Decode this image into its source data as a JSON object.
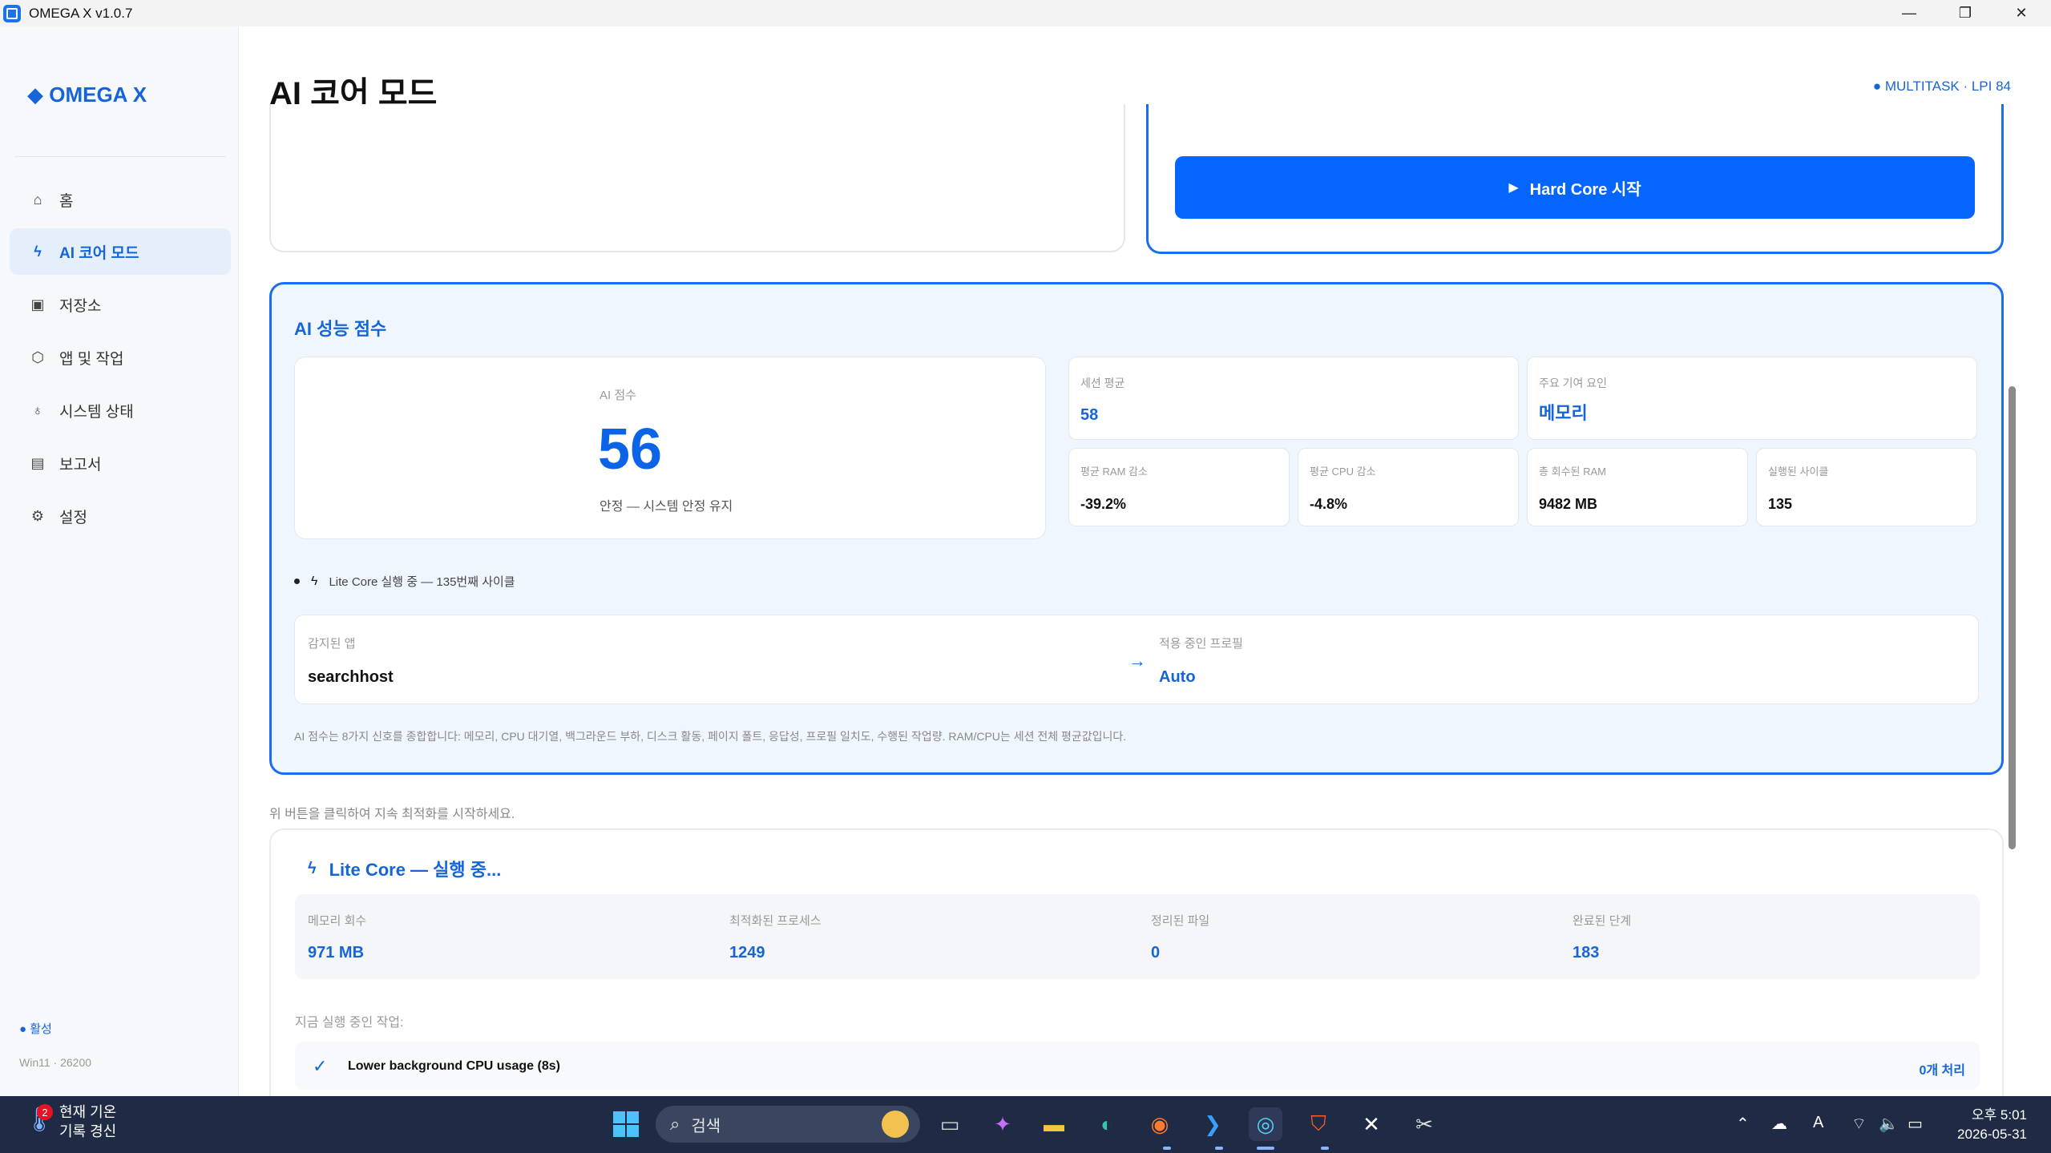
{
  "window": {
    "title": "OMEGA X v1.0.7",
    "controls": [
      "—",
      "❐",
      "✕"
    ]
  },
  "sidebar": {
    "brand": "◆ OMEGA X",
    "items": [
      {
        "label": "홈",
        "icon": "home-icon",
        "glyph": "⌂"
      },
      {
        "label": "AI 코어 모드",
        "icon": "bolt-icon",
        "glyph": "ϟ"
      },
      {
        "label": "저장소",
        "icon": "save-icon",
        "glyph": "▣"
      },
      {
        "label": "앱 및 작업",
        "icon": "cube-icon",
        "glyph": "⬡"
      },
      {
        "label": "시스템 상태",
        "icon": "stethoscope-icon",
        "glyph": "♁"
      },
      {
        "label": "보고서",
        "icon": "chart-icon",
        "glyph": "▤"
      },
      {
        "label": "설정",
        "icon": "gear-icon",
        "glyph": "⚙"
      }
    ],
    "status": "● 활성",
    "version": "Win11 · 26200"
  },
  "header": {
    "title": "AI 코어 모드",
    "mode_badge": "● MULTITASK · LPI 84"
  },
  "hardcore": {
    "button_label": "Hard Core 시작",
    "play_glyph": "▶"
  },
  "ai_score": {
    "section_title": "AI 성능 점수",
    "score_label": "AI 점수",
    "score_value": "56",
    "score_desc": "안정 — 시스템 안정 유지",
    "session_avg_label": "세션 평균",
    "session_avg_value": "58",
    "main_factor_label": "주요 기여 요인",
    "main_factor_value": "메모리",
    "ram_label": "평균 RAM 감소",
    "ram_value": "-39.2%",
    "cpu_label": "평균 CPU 감소",
    "cpu_value": "-4.8%",
    "reclaimed_label": "총 회수된 RAM",
    "reclaimed_value": "9482 MB",
    "cycles_label": "실행된 사이클",
    "cycles_value": "135",
    "cycle_line": "Lite Core 실행 중 — 135번째 사이클",
    "detected_app_label": "감지된 앱",
    "detected_app_value": "searchhost",
    "profile_label": "적용 중인 프로필",
    "profile_value": "Auto",
    "arrow": "→",
    "footnote": "AI 점수는 8가지 신호를 종합합니다: 메모리, CPU 대기열, 백그라운드 부하, 디스크 활동, 페이지 폴트, 응답성, 프로필 일치도, 수행된 작업량. RAM/CPU는 세션 전체 평균값입니다."
  },
  "hint": "위 버튼을 클릭하여 지속 최적화를 시작하세요.",
  "lite_core": {
    "title": "Lite Core — 실행 중...",
    "stats": [
      {
        "label": "메모리 회수",
        "value": "971 MB"
      },
      {
        "label": "최적화된 프로세스",
        "value": "1249"
      },
      {
        "label": "정리된 파일",
        "value": "0"
      },
      {
        "label": "완료된 단계",
        "value": "183"
      }
    ],
    "running_label": "지금 실행 중인 작업:",
    "task": {
      "check": "✓",
      "name": "Lower background CPU usage (8s)",
      "count": "0개 처리"
    }
  },
  "taskbar": {
    "weather_line1": "현재 기온",
    "weather_line2": "기록 경신",
    "weather_badge": "2",
    "search_text": "검색",
    "clock_time": "오후 5:01",
    "clock_date": "2026-05-31",
    "ime": "A"
  }
}
